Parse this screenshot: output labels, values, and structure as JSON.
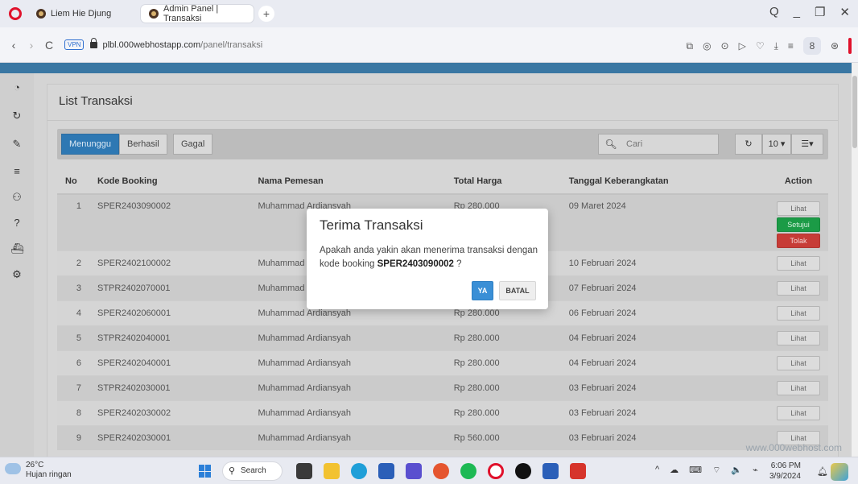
{
  "browser": {
    "tabs": [
      {
        "label": "Liem Hie Djung"
      },
      {
        "label": "Admin Panel | Transaksi"
      }
    ],
    "new_tab": "+",
    "window_controls": [
      "Q",
      "_",
      "❐",
      "✕"
    ],
    "nav": {
      "back": "‹",
      "forward": "›",
      "reload": "C"
    },
    "vpn_label": "VPN",
    "url_host": "plbl.000webhostapp.com",
    "url_path": "/panel/transaksi",
    "toolbar_icons": [
      "⧉",
      "◎",
      "⊙",
      "▷",
      "♡",
      "⤓",
      "≡",
      "8",
      "⊛"
    ]
  },
  "sidebar": {
    "icons": [
      "dashboard-icon",
      "refresh-icon",
      "tag-icon",
      "database-icon",
      "users-icon",
      "help-icon",
      "ship-icon",
      "gear-icon"
    ]
  },
  "page": {
    "title": "List Transaksi",
    "tabs": [
      {
        "label": "Menunggu"
      },
      {
        "label": "Berhasil"
      },
      {
        "label": "Gagal"
      }
    ],
    "search_placeholder": "Cari",
    "refresh_icon": "↻",
    "page_size": "10 ▾",
    "columns_icon": "☰▾",
    "table": {
      "headers": [
        "No",
        "Kode Booking",
        "Nama Pemesan",
        "Total Harga",
        "Tanggal Keberangkatan",
        "Action"
      ],
      "rows": [
        {
          "no": "1",
          "kode": "SPER2403090002",
          "nama": "Muhammad Ardiansyah",
          "total": "Rp 280.000",
          "tanggal": "09 Maret 2024"
        },
        {
          "no": "2",
          "kode": "SPER2402100002",
          "nama": "Muhammad Ardi",
          "total": "",
          "tanggal": "10 Februari 2024"
        },
        {
          "no": "3",
          "kode": "STPR2402070001",
          "nama": "Muhammad Ardi",
          "total": "",
          "tanggal": "07 Februari 2024"
        },
        {
          "no": "4",
          "kode": "SPER2402060001",
          "nama": "Muhammad Ardiansyah",
          "total": "Rp 280.000",
          "tanggal": "06 Februari 2024"
        },
        {
          "no": "5",
          "kode": "STPR2402040001",
          "nama": "Muhammad Ardiansyah",
          "total": "Rp 280.000",
          "tanggal": "04 Februari 2024"
        },
        {
          "no": "6",
          "kode": "SPER2402040001",
          "nama": "Muhammad Ardiansyah",
          "total": "Rp 280.000",
          "tanggal": "04 Februari 2024"
        },
        {
          "no": "7",
          "kode": "STPR2402030001",
          "nama": "Muhammad Ardiansyah",
          "total": "Rp 280.000",
          "tanggal": "03 Februari 2024"
        },
        {
          "no": "8",
          "kode": "SPER2402030002",
          "nama": "Muhammad Ardiansyah",
          "total": "Rp 280.000",
          "tanggal": "03 Februari 2024"
        },
        {
          "no": "9",
          "kode": "SPER2402030001",
          "nama": "Muhammad Ardiansyah",
          "total": "Rp 560.000",
          "tanggal": "03 Februari 2024"
        }
      ],
      "action_view": "Lihat",
      "action_approve": "Setujui",
      "action_reject": "Tolak"
    },
    "watermark": "www.000webhost.com"
  },
  "modal": {
    "title": "Terima Transaksi",
    "text": "Apakah anda yakin akan menerima transaksi dengan kode booking",
    "code": "SPER2403090002",
    "suffix": " ?",
    "yes": "YA",
    "cancel": "BATAL"
  },
  "taskbar": {
    "temperature": "26°C",
    "weather": "Hujan ringan",
    "search": "Search",
    "time": "6:06 PM",
    "date": "3/9/2024",
    "tray_icons": [
      "^",
      "☁",
      "⌨",
      "⌔",
      "🔈",
      "⌁"
    ]
  }
}
